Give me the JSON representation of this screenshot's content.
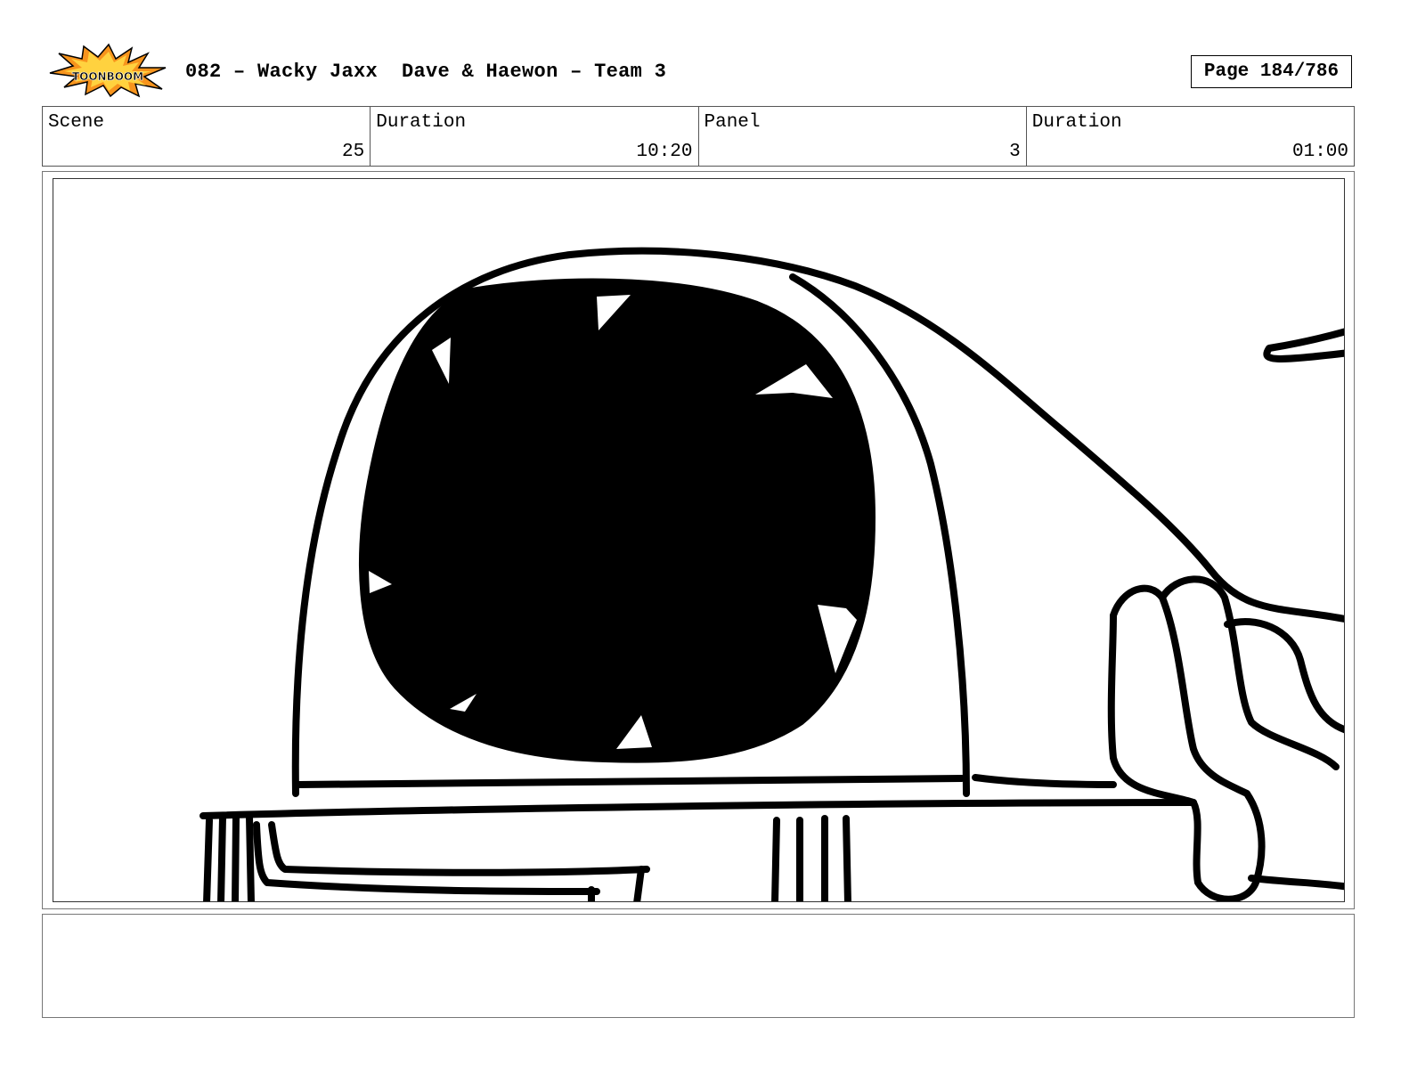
{
  "header": {
    "logo_text": "TOONBOOM",
    "title": "082 – Wacky Jaxx  Dave & Haewon – Team 3",
    "page_label": "Page 184/786"
  },
  "info": {
    "scene_label": "Scene",
    "scene_value": "25",
    "scene_duration_label": "Duration",
    "scene_duration_value": "10:20",
    "panel_label": "Panel",
    "panel_value": "3",
    "panel_duration_label": "Duration",
    "panel_duration_value": "01:00"
  },
  "notes": {
    "text": ""
  }
}
